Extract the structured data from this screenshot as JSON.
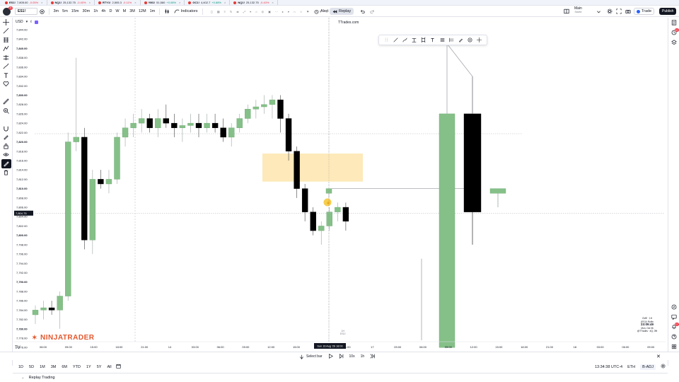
{
  "tabs": [
    {
      "symbol": "ES1!",
      "price": "7,805.00",
      "change": "-0.05%",
      "dir": "dn"
    },
    {
      "symbol": "NQ1!",
      "price": "25,132.75",
      "change": "-0.40%",
      "dir": "dn"
    },
    {
      "symbol": "RTY1!",
      "price": "2,505.3",
      "change": "-0.11%",
      "dir": "dn"
    },
    {
      "symbol": "YM1!",
      "price": "51,560",
      "change": "+0.08%",
      "dir": "up"
    },
    {
      "symbol": "GC1!",
      "price": "4,402.7",
      "change": "+0.88%",
      "dir": "up"
    },
    {
      "symbol": "NQ1!",
      "price": "25,132.75",
      "change": "-0.40%",
      "dir": "dn"
    }
  ],
  "toolbar": {
    "avatar_badge": "11",
    "symbol": "ES1!",
    "timeframes": [
      "3m",
      "5m",
      "15m",
      "30m",
      "1h",
      "4h",
      "D",
      "W",
      "M",
      "3M",
      "12M",
      "1m"
    ],
    "indicators_label": "Indicators",
    "alert_label": "Alert",
    "replay_label": "Replay",
    "layout_name": "Main",
    "layout_sub": "Saved",
    "trade_label": "Trade",
    "publish_label": "Publish"
  },
  "chart": {
    "currency": "USD",
    "watermark": "TTrades.com",
    "logo_text": "NINJATRADER",
    "tv_logo": "TV",
    "price_labels": [
      "7,844.00",
      "7,842.00",
      "7,840.00",
      "7,838.00",
      "7,836.00",
      "7,834.00",
      "7,832.00",
      "7,830.00",
      "7,828.00",
      "7,826.00",
      "7,824.00",
      "7,822.00",
      "7,820.00",
      "7,818.00",
      "7,816.00",
      "7,814.00",
      "7,812.00",
      "7,810.00",
      "7,808.00",
      "7,806.00",
      "7,804.00",
      "7,802.00",
      "7,800.00",
      "7,798.00",
      "7,796.00",
      "7,794.00",
      "7,792.00",
      "7,790.00",
      "7,788.00",
      "7,786.00",
      "7,784.00",
      "7,782.00",
      "7,780.00",
      "7,778.00",
      "7,776.00"
    ],
    "current_price_tag": "7,804.75",
    "time_labels": [
      "06:00",
      "09:00",
      "15:00",
      "18:00",
      "21:00",
      "14",
      "03:00",
      "06:00",
      "09:00",
      "12:00",
      "15:00",
      "18:00",
      "21:00",
      "17",
      "03:00",
      "06:00",
      "09:00",
      "12:00",
      "15:00",
      "18:00",
      "21:00",
      "18",
      "03:00",
      "06:00",
      "09:00"
    ],
    "cursor_time_tag": "Sun 16 Aug '26   18:00",
    "cursor_label_1": "1H",
    "cursor_label_2": "ES1!",
    "info_lines": [
      "CME · 1H",
      "(ES1!) Rollin"
    ],
    "info_time": "23:09:49",
    "info_sub": [
      "Mon, Oct 06",
      "@TTrades · #Q, 09t"
    ]
  },
  "chart_data": {
    "type": "candlestick",
    "ylim": [
      7775,
      7845
    ],
    "candles": [
      {
        "o": 7783,
        "h": 7785,
        "l": 7781,
        "c": 7784
      },
      {
        "o": 7784,
        "h": 7786,
        "l": 7782,
        "c": 7784.5
      },
      {
        "o": 7784.5,
        "h": 7786,
        "l": 7783,
        "c": 7784
      },
      {
        "o": 7784,
        "h": 7788,
        "l": 7780,
        "c": 7787
      },
      {
        "o": 7787,
        "h": 7822,
        "l": 7786,
        "c": 7820
      },
      {
        "o": 7820,
        "h": 7838,
        "l": 7818,
        "c": 7821
      },
      {
        "o": 7821,
        "h": 7823,
        "l": 7797,
        "c": 7799
      },
      {
        "o": 7799,
        "h": 7814,
        "l": 7796,
        "c": 7812
      },
      {
        "o": 7812,
        "h": 7814,
        "l": 7810,
        "c": 7811
      },
      {
        "o": 7811,
        "h": 7814,
        "l": 7809,
        "c": 7812
      },
      {
        "o": 7812,
        "h": 7822,
        "l": 7811,
        "c": 7821
      },
      {
        "o": 7821,
        "h": 7825,
        "l": 7819,
        "c": 7823
      },
      {
        "o": 7823,
        "h": 7826,
        "l": 7821,
        "c": 7824
      },
      {
        "o": 7824,
        "h": 7827,
        "l": 7822,
        "c": 7825
      },
      {
        "o": 7825,
        "h": 7826,
        "l": 7822,
        "c": 7823
      },
      {
        "o": 7823,
        "h": 7827,
        "l": 7821,
        "c": 7825
      },
      {
        "o": 7825,
        "h": 7828,
        "l": 7823,
        "c": 7824
      },
      {
        "o": 7824,
        "h": 7826,
        "l": 7821,
        "c": 7823
      },
      {
        "o": 7823,
        "h": 7825,
        "l": 7820,
        "c": 7823.5
      },
      {
        "o": 7823.5,
        "h": 7826,
        "l": 7822,
        "c": 7824
      },
      {
        "o": 7824,
        "h": 7826,
        "l": 7821,
        "c": 7823
      },
      {
        "o": 7823,
        "h": 7826,
        "l": 7822,
        "c": 7824
      },
      {
        "o": 7824,
        "h": 7826,
        "l": 7822,
        "c": 7823
      },
      {
        "o": 7823,
        "h": 7825,
        "l": 7820,
        "c": 7821
      },
      {
        "o": 7821,
        "h": 7824,
        "l": 7819,
        "c": 7823
      },
      {
        "o": 7823,
        "h": 7826,
        "l": 7822,
        "c": 7825
      },
      {
        "o": 7825,
        "h": 7828,
        "l": 7824,
        "c": 7827
      },
      {
        "o": 7827,
        "h": 7829,
        "l": 7825,
        "c": 7827.5
      },
      {
        "o": 7827.5,
        "h": 7830,
        "l": 7826,
        "c": 7828
      },
      {
        "o": 7828,
        "h": 7830,
        "l": 7825,
        "c": 7829
      },
      {
        "o": 7829,
        "h": 7830,
        "l": 7822,
        "c": 7825
      },
      {
        "o": 7825,
        "h": 7826,
        "l": 7816,
        "c": 7818
      },
      {
        "o": 7818,
        "h": 7819,
        "l": 7808,
        "c": 7810
      },
      {
        "o": 7810,
        "h": 7811,
        "l": 7803,
        "c": 7805
      },
      {
        "o": 7805,
        "h": 7806,
        "l": 7800,
        "c": 7801
      },
      {
        "o": 7801,
        "h": 7803,
        "l": 7798,
        "c": 7802
      },
      {
        "o": 7802,
        "h": 7806,
        "l": 7801,
        "c": 7805
      },
      {
        "o": 7805,
        "h": 7807,
        "l": 7803,
        "c": 7806
      },
      {
        "o": 7806,
        "h": 7807,
        "l": 7801,
        "c": 7803
      },
      {
        "o": 7809,
        "h": 7810,
        "l": 7808,
        "c": 7810
      }
    ],
    "htf_candles": [
      {
        "o": 7776,
        "h": 7826,
        "l": 7776,
        "c": 7826
      },
      {
        "o": 7826,
        "h": 7834,
        "l": 7798,
        "c": 7805
      },
      {
        "o": 7809,
        "h": 7810,
        "l": 7806,
        "c": 7810
      }
    ],
    "zone": {
      "from": 7817.5,
      "to": 7811.5
    },
    "colors": {
      "up": "#85c088",
      "down": "#000000",
      "zone": "#fde9b9",
      "marker": "#f4c430"
    }
  },
  "replay": {
    "select_bar_label": "Select bar",
    "speed": "10x",
    "interval": "1h"
  },
  "range": {
    "items": [
      "1D",
      "5D",
      "1M",
      "3M",
      "6M",
      "YTD",
      "1Y",
      "5Y",
      "All"
    ],
    "clock": "13:34:38 UTC-4",
    "session": "ETH",
    "adj": "B-ADJ"
  },
  "bottom": {
    "label": "Replay Trading"
  }
}
